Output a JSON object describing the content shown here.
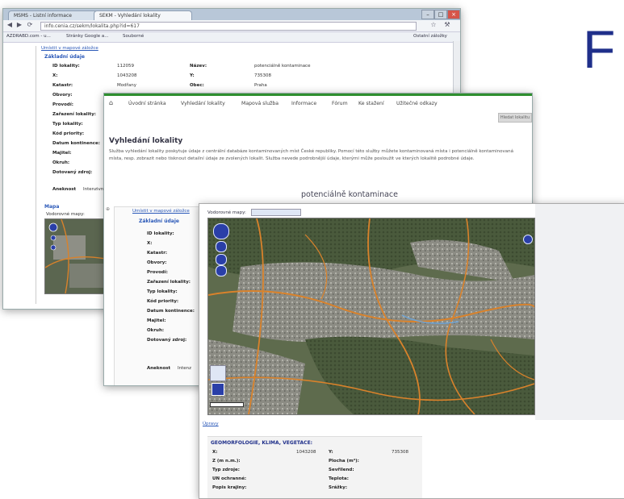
{
  "big_letter": "F",
  "window1": {
    "tabs": [
      "MSMS - Listní informace",
      "SEKM - Vyhledání lokality"
    ],
    "url": "info.cenia.cz/sekm/lokalita.php?id=617",
    "bookmarks": [
      "AZDRABD.com - u...",
      "Stránky Google a...",
      "Souborné",
      "Ostatní záložky"
    ],
    "breadcrumb_link": "Umístit v mapové záložce",
    "section_title": "Základní údaje",
    "fields": [
      {
        "label": "ID lokality:",
        "value": "112059"
      },
      {
        "label": "X:",
        "value": "1043208"
      },
      {
        "label": "Katastr:",
        "value": "Modřany"
      },
      {
        "label": "Obvory:",
        "value": ""
      },
      {
        "label": "Provodí:",
        "value": ""
      },
      {
        "label": "Zařazení lokality:",
        "value": ""
      },
      {
        "label": "Typ lokality:",
        "value": ""
      },
      {
        "label": "Kód priority:",
        "value": ""
      },
      {
        "label": "Datum kontinence:",
        "value": ""
      },
      {
        "label": "Majitel:",
        "value": ""
      },
      {
        "label": "Okruh:",
        "value": ""
      },
      {
        "label": "Dotovaný zdroj:",
        "value": ""
      }
    ],
    "right_fields": [
      {
        "label": "Název:",
        "value": "potenciálně kontaminace"
      },
      {
        "label": "Y:",
        "value": "735308"
      },
      {
        "label": "Obec:",
        "value": "Praha"
      }
    ],
    "hodnoceni_label": "Aneknost",
    "hodnoceni_value": "Intenzivní",
    "map_label": "Mapa",
    "map_tools_label": "Vodorovné mapy:"
  },
  "window2": {
    "menu": [
      "Úvodní stránka",
      "Vyhledání lokality",
      "Mapová služba",
      "Informace",
      "Fórum",
      "Ke stažení",
      "Užitečné odkazy"
    ],
    "search_button": "Hledat lokalitu",
    "page_title": "Vyhledání lokality",
    "description": "Služba vyhledání lokality poskytuje údaje z centrální databáze kontaminovaných míst České republiky. Pomocí této služby můžete kontaminovaná místa i potenciálně kontaminovaná místa, resp. zobrazit nebo tisknout detailní údaje ze zvolených lokalit. Služba nevede podrobnější údaje, kterými může posloužit ve kterých lokalitě podrobné údaje.",
    "inner_title": "potenciálně kontaminace",
    "inner_link": "Umístit v mapové záložce",
    "inner_section": "Základní údaje",
    "inner_fields": [
      "ID lokality:",
      "X:",
      "Katastr:",
      "Obvory:",
      "Provodí:",
      "Zařazení lokality:",
      "Typ lokality:",
      "Kód priority:",
      "Datum kontinence:",
      "Majitel:",
      "Okruh:",
      "Dotovaný zdroj:"
    ],
    "inner_aneknost": "Aneknost",
    "inner_aneknost_val": "Intenz"
  },
  "window3": {
    "map_tools": "Vodorovné mapy:",
    "bottom_link": "Úpravy",
    "geo_title": "GEOMORFOLOGIE, KLIMA, VEGETACE:",
    "geo_left": [
      {
        "label": "X:",
        "value": "1043208"
      },
      {
        "label": "Z (m n.m.):",
        "value": ""
      },
      {
        "label": "Typ zdroje:",
        "value": ""
      },
      {
        "label": "UN ochranné:",
        "value": ""
      },
      {
        "label": "Popis krajiny:",
        "value": ""
      }
    ],
    "geo_right": [
      {
        "label": "Y:",
        "value": "735308"
      },
      {
        "label": "Plocha (m²):",
        "value": ""
      },
      {
        "label": "Sevřilend:",
        "value": ""
      },
      {
        "label": "Teplota:",
        "value": ""
      },
      {
        "label": "Srážky:",
        "value": ""
      }
    ]
  },
  "colors": {
    "accent_blue": "#1f2f8a",
    "menu_green": "#2f8f2f",
    "link_blue": "#2a58b8",
    "road_orange": "#d9822b"
  }
}
